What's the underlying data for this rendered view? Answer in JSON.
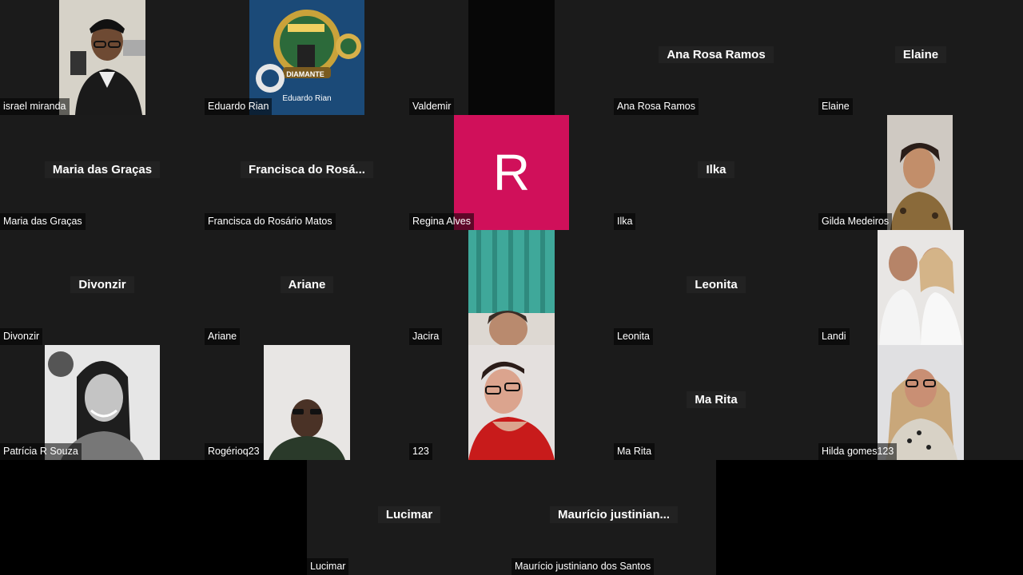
{
  "participants": [
    {
      "name": "israel miranda",
      "display": "",
      "kind": "video"
    },
    {
      "name": "Eduardo Rian",
      "display": "",
      "kind": "video",
      "overlay_text": "Eduardo Rian",
      "badge_text": "DIAMANTE"
    },
    {
      "name": "Valdemir",
      "display": "",
      "kind": "video-dark"
    },
    {
      "name": "Ana Rosa Ramos",
      "display": "Ana Rosa Ramos",
      "kind": "name"
    },
    {
      "name": "Elaine",
      "display": "Elaine",
      "kind": "name"
    },
    {
      "name": "Maria das Graças",
      "display": "Maria das Graças",
      "kind": "name"
    },
    {
      "name": "Francisca do Rosário Matos",
      "display": "Francisca do Rosá...",
      "kind": "name"
    },
    {
      "name": "Regina Alves",
      "display": "",
      "kind": "avatar",
      "avatar_letter": "R"
    },
    {
      "name": "Ilka",
      "display": "Ilka",
      "kind": "name"
    },
    {
      "name": "Gilda Medeiros",
      "display": "",
      "kind": "video"
    },
    {
      "name": "Divonzir",
      "display": "Divonzir",
      "kind": "name"
    },
    {
      "name": "Ariane",
      "display": "Ariane",
      "kind": "name"
    },
    {
      "name": "Jacira",
      "display": "",
      "kind": "video"
    },
    {
      "name": "Leonita",
      "display": "Leonita",
      "kind": "name"
    },
    {
      "name": "Landi",
      "display": "",
      "kind": "video"
    },
    {
      "name": "Patrícia R Souza",
      "display": "",
      "kind": "video"
    },
    {
      "name": "Rogérioq23",
      "display": "",
      "kind": "video"
    },
    {
      "name": "123",
      "display": "",
      "kind": "video"
    },
    {
      "name": "Ma Rita",
      "display": "Ma Rita",
      "kind": "name"
    },
    {
      "name": "Hilda gomes123",
      "display": "",
      "kind": "video"
    }
  ],
  "bottom_participants": [
    {
      "name": "Lucimar",
      "display": "Lucimar",
      "kind": "name"
    },
    {
      "name": "Maurício justiniano dos Santos",
      "display": "Maurício  justinian...",
      "kind": "name"
    }
  ],
  "colors": {
    "tile_bg": "#1b1b1b",
    "avatar_bg": "#d0105a",
    "background": "#000000"
  }
}
